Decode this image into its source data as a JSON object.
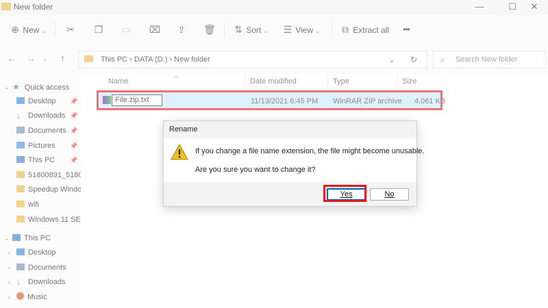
{
  "window": {
    "title": "New folder",
    "minimize": "—",
    "maximize": "☐",
    "close": "✕"
  },
  "toolbar": {
    "new_label": "New",
    "sort_label": "Sort",
    "view_label": "View",
    "extract_label": "Extract all",
    "more_label": "•••"
  },
  "nav": {
    "path": "This PC  ›  DATA (D:)  ›  New folder",
    "search_placeholder": "Search New folder"
  },
  "sidebar": {
    "quick_access": "Quick access",
    "quick_items": [
      "Desktop",
      "Downloads",
      "Documents",
      "Pictures",
      "This PC",
      "51800891_51800",
      "Speedup Windo",
      "wifi",
      "Windows 11 SE"
    ],
    "this_pc": "This PC",
    "pc_items": [
      "Desktop",
      "Documents",
      "Downloads",
      "Music"
    ]
  },
  "columns": {
    "name": "Name",
    "date": "Date modified",
    "type": "Type",
    "size": "Size"
  },
  "file": {
    "name_edit": "File.zip.txt",
    "date": "11/13/2021 6:45 PM",
    "type": "WinRAR ZIP archive",
    "size": "4,061 KB"
  },
  "dialog": {
    "title": "Rename",
    "line1": "If you change a file name extension, the file might become unusable.",
    "line2": "Are you sure you want to change it?",
    "yes": "Yes",
    "no": "No"
  },
  "colors": {
    "highlight": "#e01a22",
    "selection": "#cce8ff",
    "folder": "#e8b84a"
  }
}
